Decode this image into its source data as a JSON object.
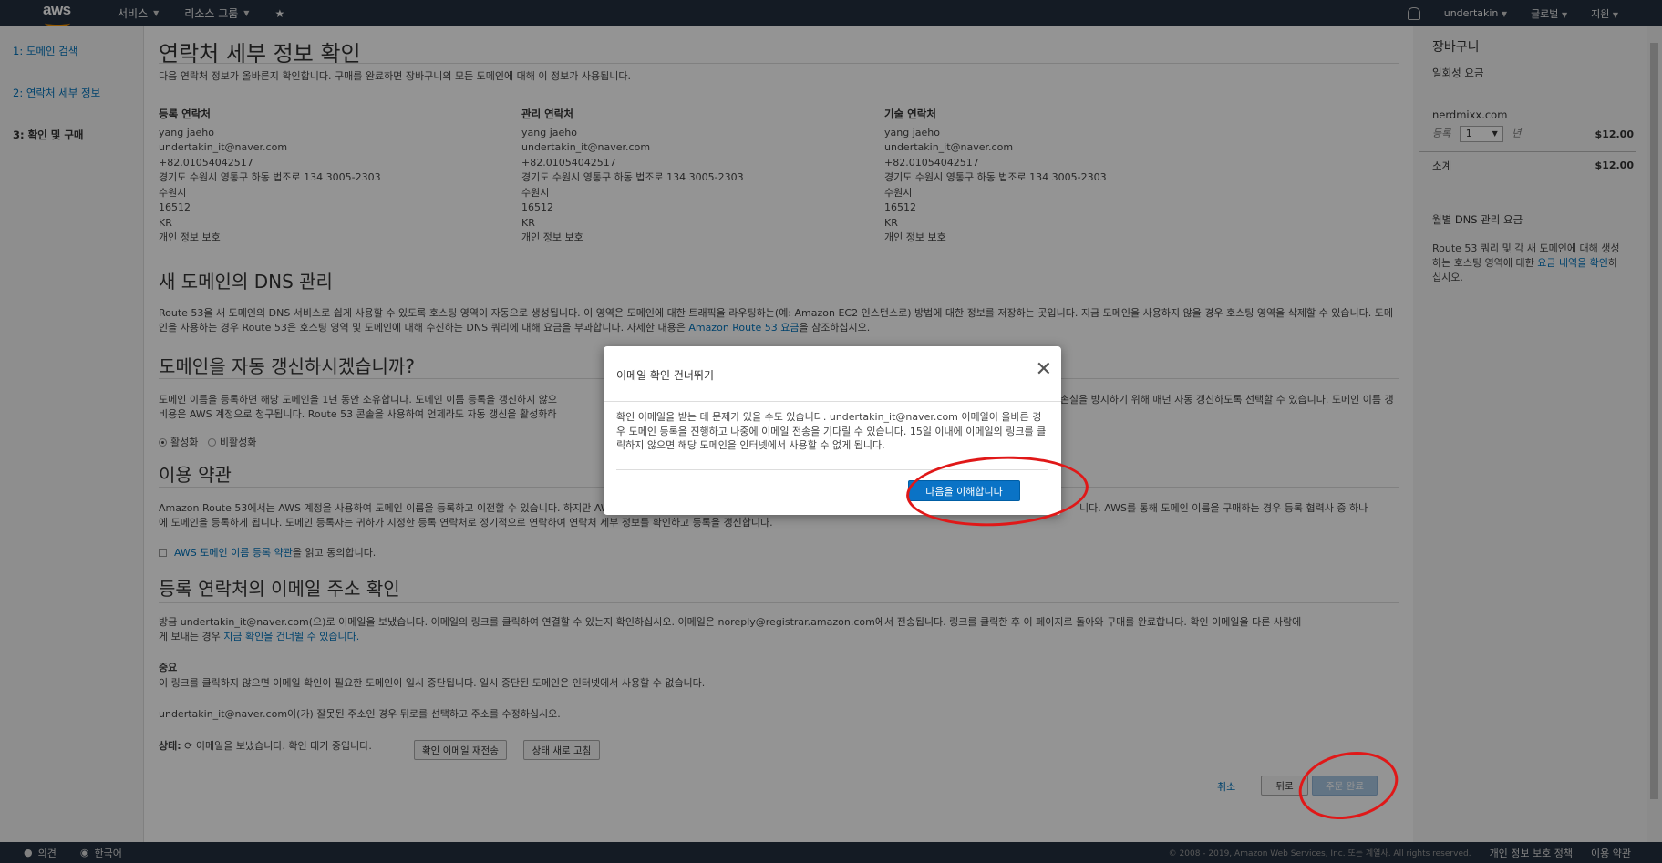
{
  "header": {
    "logo": "aws",
    "services": "서비스",
    "resource_groups": "리소스 그룹",
    "user": "undertakin",
    "region": "글로벌",
    "support": "지원"
  },
  "sidebar": {
    "items": [
      {
        "label": "1: 도메인 검색"
      },
      {
        "label": "2: 연락처 세부 정보"
      },
      {
        "label": "3: 확인 및 구매"
      }
    ]
  },
  "main": {
    "title": "연락처 세부 정보 확인",
    "intro": "다음 연락처 정보가 올바른지 확인합니다. 구매를 완료하면 장바구니의 모든 도메인에 대해 이 정보가 사용됩니다.",
    "contacts": [
      {
        "heading": "등록 연락처",
        "lines": [
          "yang jaeho",
          "undertakin_it@naver.com",
          "+82.01054042517",
          "경기도 수원시 영통구 하동 법조로 134 3005-2303",
          "수원시",
          "16512",
          "KR",
          "개인 정보 보호"
        ]
      },
      {
        "heading": "관리 연락처",
        "lines": [
          "yang jaeho",
          "undertakin_it@naver.com",
          "+82.01054042517",
          "경기도 수원시 영통구 하동 법조로 134 3005-2303",
          "수원시",
          "16512",
          "KR",
          "개인 정보 보호"
        ]
      },
      {
        "heading": "기술 연락처",
        "lines": [
          "yang jaeho",
          "undertakin_it@naver.com",
          "+82.01054042517",
          "경기도 수원시 영통구 하동 법조로 134 3005-2303",
          "수원시",
          "16512",
          "KR",
          "개인 정보 보호"
        ]
      }
    ],
    "dns_title": "새 도메인의 DNS 관리",
    "dns_text": "Route 53을 새 도메인의 DNS 서비스로 쉽게 사용할 수 있도록 호스팅 영역이 자동으로 생성됩니다. 이 영역은 도메인에 대한 트래픽을 라우팅하는(예: Amazon EC2 인스턴스로) 방법에 대한 정보를 저장하는 곳입니다. 지금 도메인을 사용하지 않을 경우 호스팅 영역을 삭제할 수 있습니다. 도메인을 사용하는 경우 Route 53은 호스팅 영역 및 도메인에 대해 수신하는 DNS 쿼리에 대해 요금을 부과합니다. 자세한 내용은",
    "dns_link": "Amazon Route 53 요금",
    "dns_suffix": "을 참조하십시오.",
    "renew_title": "도메인을 자동 갱신하시겠습니까?",
    "renew_text_a": "도메인 이름을 등록하면 해당 도메인을 1년 동안 소유합니다. 도메인 이름 등록을 갱신하지 않으",
    "renew_text_b": "도메인 등록 만료 및 소유권 손실을 방지하기 위해 매년 자동 갱신하도록 선택할 수 있습니다. 도메인 이름 갱신",
    "renew_text_c": "비용은 AWS 계정으로 청구됩니다. Route 53 콘솔을 사용하여 언제라도 자동 갱신을 활성화하",
    "radio_on": "활성화",
    "radio_off": "비활성화",
    "terms_title": "이용 약관",
    "terms_text_a": "Amazon Route 53에서는 AWS 계정을 사용하여 도메인 이름을 등록하고 이전할 수 있습니다. 하지만 AWS는",
    "terms_text_b": "니다. AWS를 통해 도메인 이름을 구매하는 경우 등록 협력사 중 하나",
    "terms_text_c": "에 도메인을 등록하게 됩니다. 도메인 등록자는 귀하가 지정한 등록 연락처로 정기적으로 연락하여 연락처 세부 정보를 확인하고 등록을 갱신합니다.",
    "terms_link": "AWS 도메인 이름 등록 약관",
    "terms_suffix": "을 읽고 동의합니다.",
    "email_title": "등록 연락처의 이메일 주소 확인",
    "email_text": "방금 undertakin_it@naver.com(으)로 이메일을 보냈습니다. 이메일의 링크를 클릭하여 연결할 수 있는지 확인하십시오. 이메일은 noreply@registrar.amazon.com에서 전송됩니다. 링크를 클릭한 후 이 페이지로 돌아와 구매를 완료합니다. 확인 이메일을 다른 사람에",
    "email_text2": "게 보내는 경우",
    "email_link": "지금 확인을 건너뛸 수 있습니다.",
    "important": "중요",
    "important_text": "이 링크를 클릭하지 않으면 이메일 확인이 필요한 도메인이 일시 중단됩니다. 일시 중단된 도메인은 인터넷에서 사용할 수 없습니다.",
    "wrong_addr": "undertakin_it@naver.com이(가) 잘못된 주소인 경우 뒤로를 선택하고 주소를 수정하십시오.",
    "status_label": "상태:",
    "status_text": "이메일을 보냈습니다. 확인 대기 중입니다.",
    "resend_button": "확인 이메일 재전송",
    "refresh_button": "상태 새로 고침",
    "cancel": "취소",
    "back": "뒤로",
    "complete": "주문 완료"
  },
  "cart": {
    "title": "장바구니",
    "one_time": "일회성 요금",
    "domain": "nerdmixx.com",
    "reg_label": "등록",
    "years_value": "1",
    "years_unit": "년",
    "price": "$12.00",
    "subtotal_label": "소계",
    "subtotal": "$12.00",
    "monthly_title": "월별 DNS 관리 요금",
    "monthly_text": "Route 53 쿼리 및 각 새 도메인에 대해 생성하는 호스팅 영역에 대한",
    "monthly_link": "요금 내역을 확인",
    "monthly_suffix": "하십시오."
  },
  "modal": {
    "title": "이메일 확인 건너뛰기",
    "body": "확인 이메일을 받는 데 문제가 있을 수도 있습니다. undertakin_it@naver.com 이메일이 올바른 경우 도메인 등록을 진행하고 나중에 이메일 전송을 기다릴 수 있습니다. 15일 이내에 이메일의 링크를 클릭하지 않으면 해당 도메인을 인터넷에서 사용할 수 없게 됩니다.",
    "ok_button": "다음을 이해합니다"
  },
  "footer": {
    "feedback": "의견",
    "language": "한국어",
    "copyright": "© 2008 - 2019, Amazon Web Services, Inc. 또는 계열사. All rights reserved.",
    "privacy": "개인 정보 보호 정책",
    "terms": "이용 약관"
  },
  "colors": {
    "accent": "#0073bb",
    "header_bg": "#232f3e",
    "primary_button": "#0a73c6",
    "annotation": "#e01818"
  }
}
